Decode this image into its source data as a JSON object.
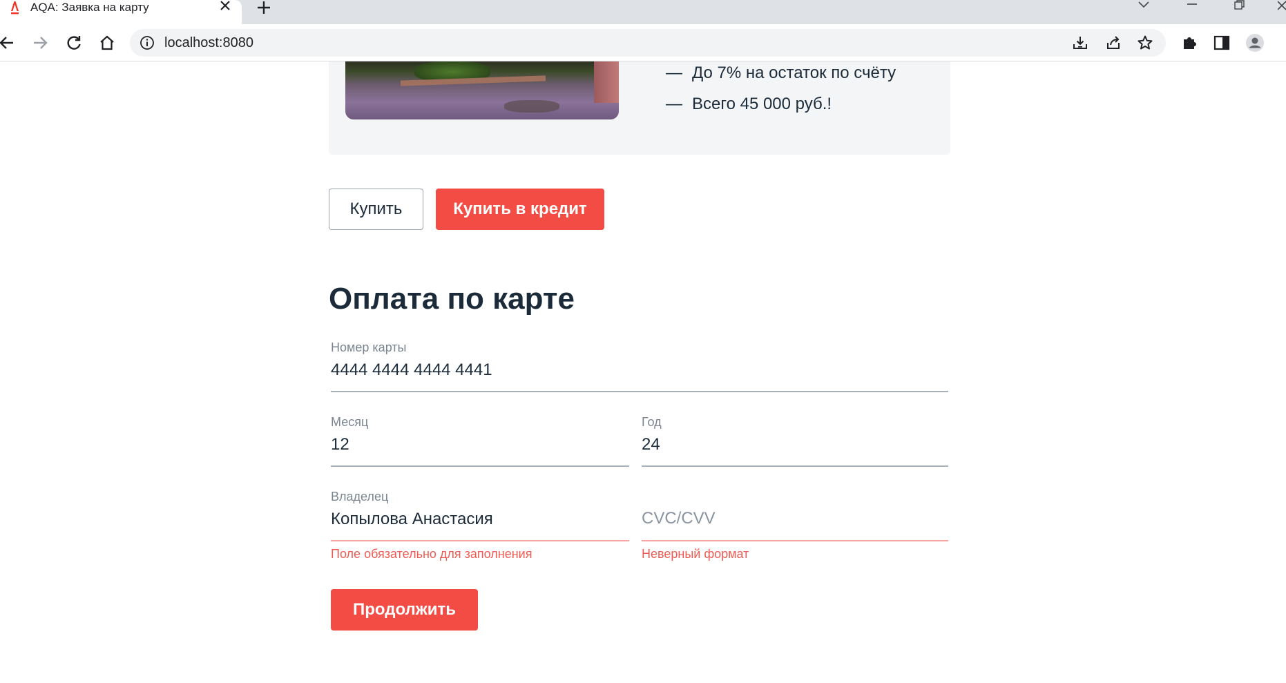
{
  "browser": {
    "tab_title": "AQA: Заявка на карту",
    "url": "localhost:8080",
    "icons": {
      "logo": "alfa-logo-icon",
      "close": "close-icon",
      "new_tab": "plus-icon",
      "back": "arrow-left-icon",
      "forward": "arrow-right-icon",
      "reload": "reload-icon",
      "home": "home-icon",
      "info": "info-icon",
      "install": "install-icon",
      "share": "share-icon",
      "bookmark": "star-icon",
      "extensions": "puzzle-icon",
      "side_panel": "side-panel-icon",
      "profile": "profile-icon"
    }
  },
  "promo": {
    "features": [
      "До 7% на остаток по счёту",
      "Всего 45 000 руб.!"
    ],
    "dash": "—"
  },
  "actions": {
    "buy_label": "Купить",
    "credit_label": "Купить в кредит"
  },
  "payment_form": {
    "title": "Оплата по карте",
    "card_number": {
      "label": "Номер карты",
      "value": "4444 4444 4444 4441"
    },
    "month": {
      "label": "Месяц",
      "value": "12"
    },
    "year": {
      "label": "Год",
      "value": "24"
    },
    "owner": {
      "label": "Владелец",
      "value": "Копылова Анастасия",
      "error": "Поле обязательно для заполнения"
    },
    "cvc": {
      "placeholder": "CVC/CVV",
      "value": "",
      "error": "Неверный формат"
    },
    "submit_label": "Продолжить"
  },
  "colors": {
    "accent": "#f34c44",
    "error_text": "#f05a52",
    "text_primary": "#1b2b3a",
    "card_bg": "#f4f5f7"
  }
}
